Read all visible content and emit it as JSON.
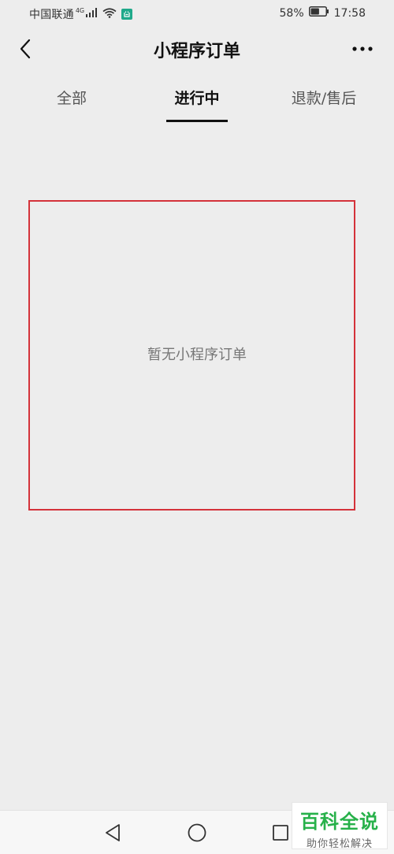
{
  "status_bar": {
    "carrier": "中国联通",
    "network": "4G",
    "battery_percent": "58%",
    "battery_level": 0.58,
    "time": "17:58"
  },
  "header": {
    "title": "小程序订单"
  },
  "tabs": [
    {
      "label": "全部",
      "active": false
    },
    {
      "label": "进行中",
      "active": true
    },
    {
      "label": "退款/售后",
      "active": false
    }
  ],
  "empty_state": {
    "message": "暂无小程序订单"
  },
  "watermark": {
    "main": "百科全说",
    "sub": "助你轻松解决"
  },
  "colors": {
    "background": "#ededed",
    "highlight_border": "#d4323a",
    "app_badge": "#1fa98a",
    "watermark_green": "#27b14a"
  },
  "icons": {
    "back": "chevron-left-icon",
    "more": "more-dots-icon",
    "nav_back": "triangle-back-icon",
    "nav_home": "circle-home-icon",
    "nav_recent": "square-recent-icon"
  }
}
